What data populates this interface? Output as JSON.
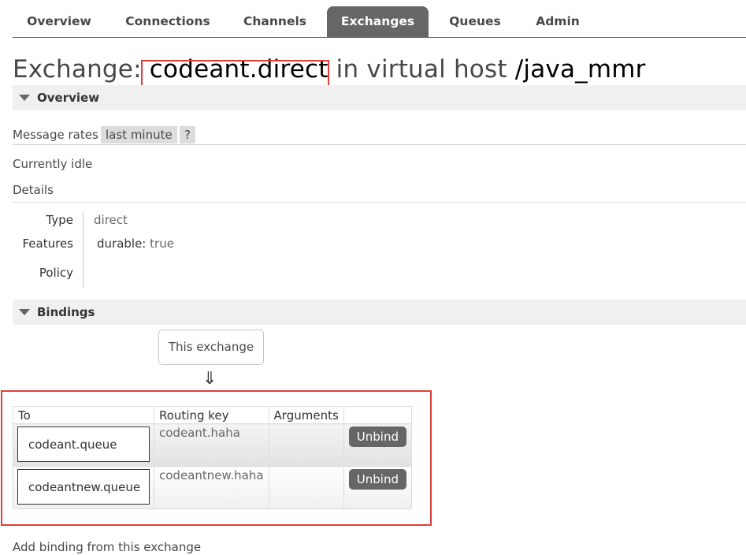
{
  "nav": {
    "tabs": [
      {
        "label": "Overview",
        "active": false
      },
      {
        "label": "Connections",
        "active": false
      },
      {
        "label": "Channels",
        "active": false
      },
      {
        "label": "Exchanges",
        "active": true
      },
      {
        "label": "Queues",
        "active": false
      },
      {
        "label": "Admin",
        "active": false
      }
    ]
  },
  "title": {
    "prefix": "Exchange: ",
    "name": "codeant.direct",
    "middle": " in virtual host ",
    "vhost": "/java_mmr"
  },
  "overview": {
    "header": "Overview",
    "message_rates_label": "Message rates",
    "rate_period": "last minute",
    "help": "?",
    "status": "Currently idle",
    "details_label": "Details",
    "type_label": "Type",
    "type_value": "direct",
    "features_label": "Features",
    "feature_key": "durable:",
    "feature_value": "true",
    "policy_label": "Policy"
  },
  "bindings": {
    "header": "Bindings",
    "this_exchange": "This exchange",
    "arrow": "⇓",
    "columns": [
      "To",
      "Routing key",
      "Arguments",
      ""
    ],
    "rows": [
      {
        "to": "codeant.queue",
        "routing_key": "codeant.haha",
        "arguments": "",
        "action": "Unbind"
      },
      {
        "to": "codeantnew.queue",
        "routing_key": "codeantnew.haha",
        "arguments": "",
        "action": "Unbind"
      }
    ],
    "add_binding": "Add binding from this exchange"
  },
  "colors": {
    "nav_active_bg": "#666666",
    "highlight": "#e03c3c",
    "section_bg": "#f0f0f0"
  }
}
